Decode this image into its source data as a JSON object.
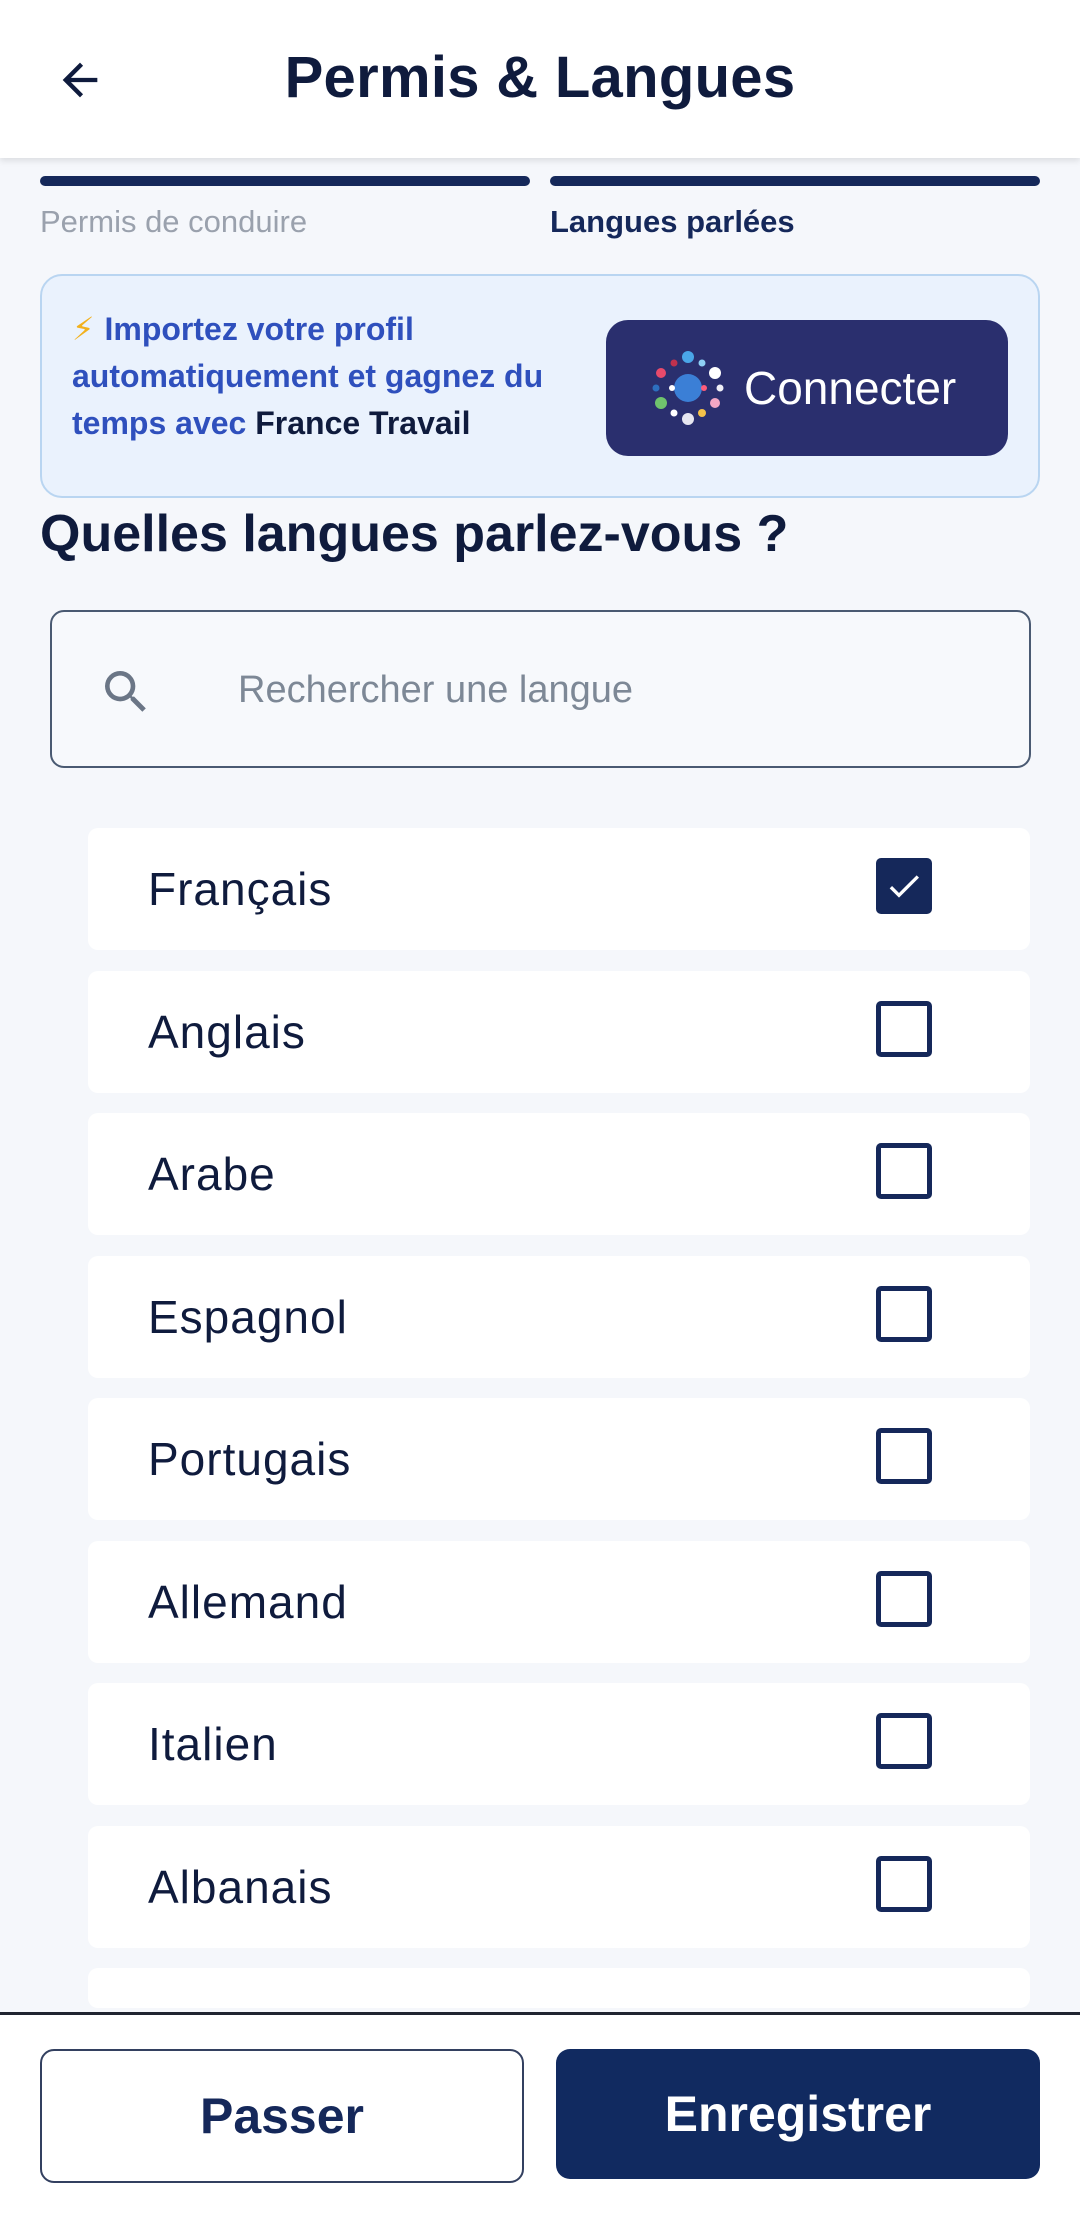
{
  "header": {
    "title": "Permis & Langues",
    "back_icon": "arrow-left-icon"
  },
  "stepper": {
    "steps": [
      {
        "label": "Permis de conduire",
        "state": "done"
      },
      {
        "label": "Langues parlées",
        "state": "current"
      }
    ]
  },
  "banner": {
    "icon": "lightning-icon",
    "text_prefix": "Importez votre profil automatiquement et gagnez du temps avec",
    "text_brand": "France Travail",
    "connect_label": "Connecter"
  },
  "question": "Quelles langues parlez-vous ?",
  "search": {
    "placeholder": "Rechercher une langue",
    "value": ""
  },
  "languages": [
    {
      "name": "Français",
      "checked": true
    },
    {
      "name": "Anglais",
      "checked": false
    },
    {
      "name": "Arabe",
      "checked": false
    },
    {
      "name": "Espagnol",
      "checked": false
    },
    {
      "name": "Portugais",
      "checked": false
    },
    {
      "name": "Allemand",
      "checked": false
    },
    {
      "name": "Italien",
      "checked": false
    },
    {
      "name": "Albanais",
      "checked": false
    }
  ],
  "actions": {
    "skip_label": "Passer",
    "save_label": "Enregistrer"
  },
  "colors": {
    "primary": "#15285a",
    "banner_bg": "#eaf2fd",
    "banner_link": "#2f50bd",
    "connect_bg": "#2a2f6e"
  }
}
